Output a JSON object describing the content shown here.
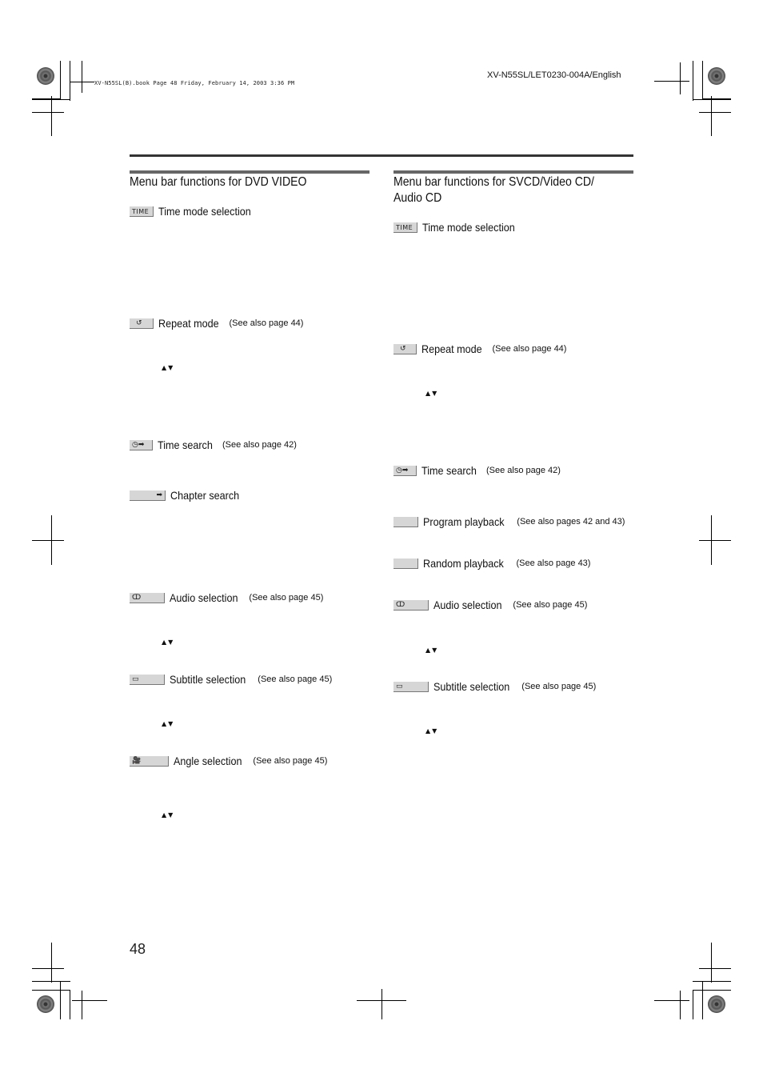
{
  "header": {
    "book_info": "XV-N55SL(B).book  Page 48  Friday, February 14, 2003  3:36 PM",
    "doc_id": "XV-N55SL/LET0230-004A/English"
  },
  "left_column": {
    "heading": "Menu bar functions for DVD VIDEO",
    "items": [
      {
        "icon": "time-icon",
        "glyph": "TIME",
        "label": "Time mode selection",
        "ref": ""
      },
      {
        "icon": "repeat-icon",
        "glyph": "↺",
        "label": "Repeat mode",
        "ref": "(See also page 44)"
      },
      {
        "icon": "time-search-icon",
        "glyph": "◷➡",
        "label": "Time search",
        "ref": "(See also page 42)"
      },
      {
        "icon": "chapter-search-icon",
        "glyph": "➡",
        "label": "Chapter search",
        "ref": ""
      },
      {
        "icon": "audio-icon",
        "glyph": "ↀ",
        "label": "Audio selection",
        "ref": "(See also page 45)"
      },
      {
        "icon": "subtitle-icon",
        "glyph": "▭",
        "label": "Subtitle selection",
        "ref": "(See also page 45)"
      },
      {
        "icon": "angle-icon",
        "glyph": "🎥",
        "label": "Angle selection",
        "ref": "(See also page 45)"
      }
    ],
    "arrow_marks": [
      "▲▼",
      "▲▼",
      "▲▼",
      "▲▼"
    ]
  },
  "right_column": {
    "heading_line1": "Menu bar functions for SVCD/Video CD/",
    "heading_line2": "Audio CD",
    "items": [
      {
        "icon": "time-icon",
        "glyph": "TIME",
        "label": "Time mode selection",
        "ref": ""
      },
      {
        "icon": "repeat-icon",
        "glyph": "↺",
        "label": "Repeat mode",
        "ref": "(See also page 44)"
      },
      {
        "icon": "time-search-icon",
        "glyph": "◷➡",
        "label": "Time search",
        "ref": "(See also page 42)"
      },
      {
        "icon": "program-icon",
        "glyph": "",
        "label": "Program playback",
        "ref": "(See also pages 42 and 43)"
      },
      {
        "icon": "random-icon",
        "glyph": "",
        "label": "Random playback",
        "ref": "(See also page 43)"
      },
      {
        "icon": "audio-icon",
        "glyph": "ↀ",
        "label": "Audio selection",
        "ref": "(See also page 45)"
      },
      {
        "icon": "subtitle-icon",
        "glyph": "▭",
        "label": "Subtitle selection",
        "ref": "(See also page 45)"
      }
    ],
    "arrow_marks": [
      "▲▼",
      "▲▼",
      "▲▼"
    ]
  },
  "footer": {
    "page_number": "48"
  }
}
